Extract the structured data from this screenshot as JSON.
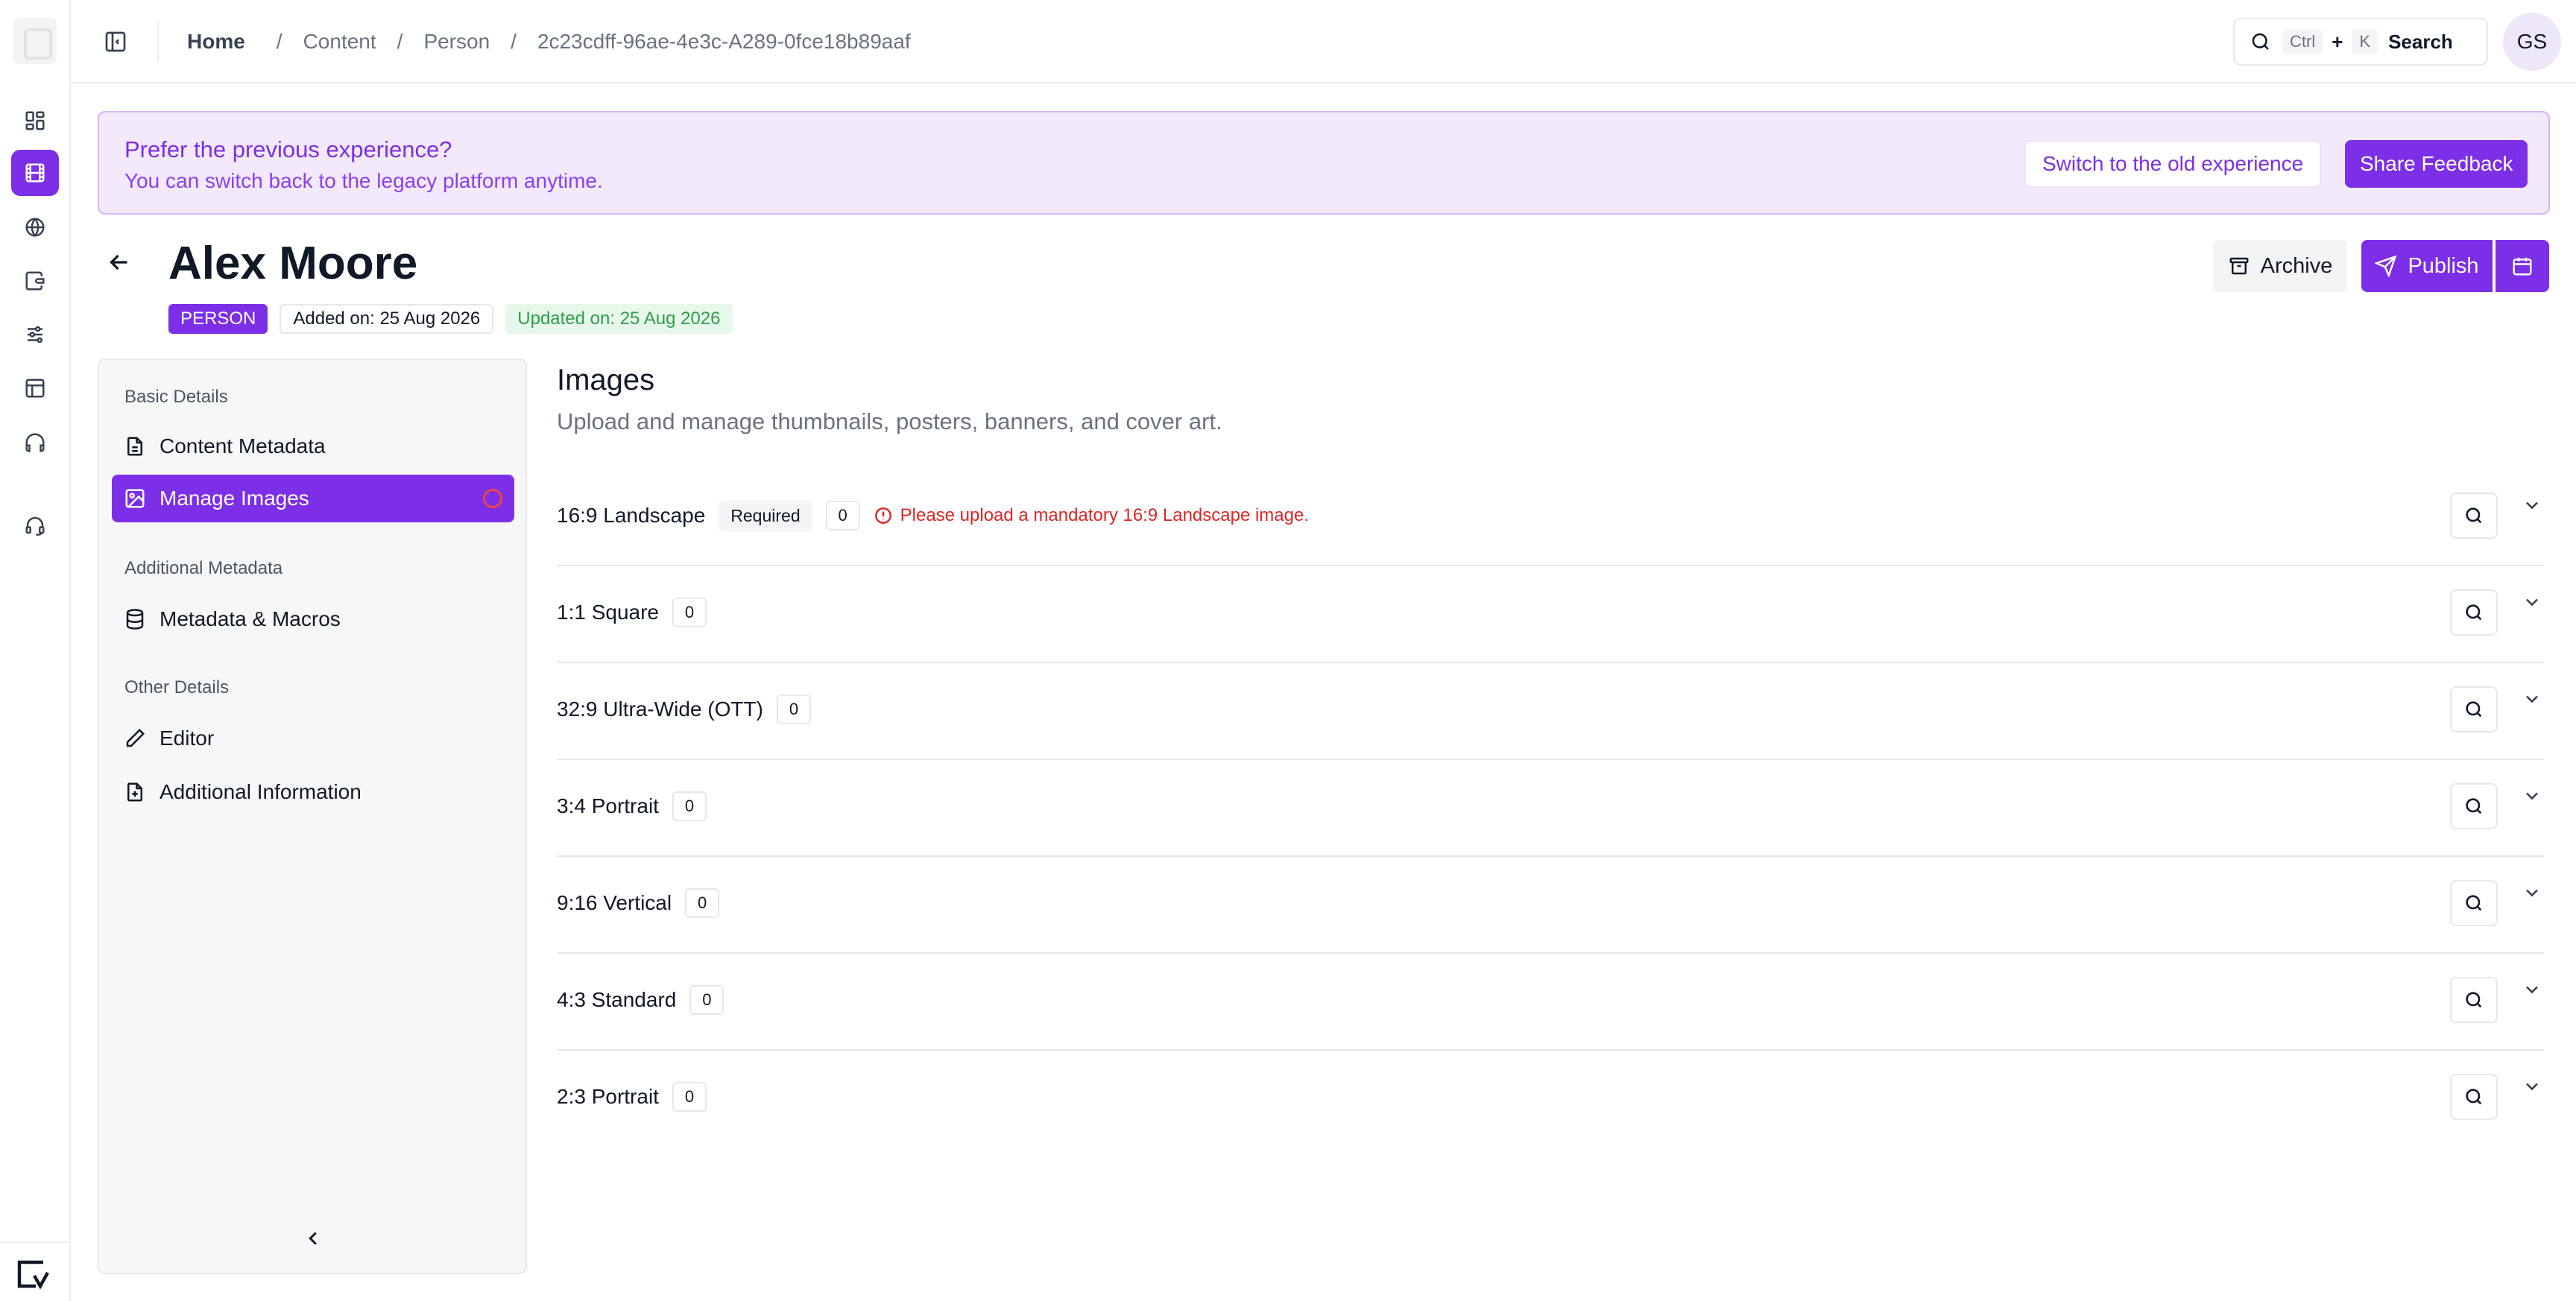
{
  "rail": {
    "items": [
      {
        "name": "dashboard-icon",
        "active": false
      },
      {
        "name": "film-icon",
        "active": true
      },
      {
        "name": "globe-icon",
        "active": false
      },
      {
        "name": "wallet-icon",
        "active": false
      },
      {
        "name": "sliders-icon",
        "active": false
      },
      {
        "name": "layout-icon",
        "active": false
      },
      {
        "name": "headphones-icon",
        "active": false
      },
      {
        "name": "headset-icon",
        "active": false
      }
    ]
  },
  "breadcrumb": {
    "home": "Home",
    "items": [
      "Content",
      "Person",
      "2c23cdff-96ae-4e3c-A289-0fce18b89aaf"
    ]
  },
  "search": {
    "kbd_ctrl": "Ctrl",
    "plus": "+",
    "kbd_key": "K",
    "label": "Search"
  },
  "user": {
    "initials": "GS"
  },
  "banner": {
    "title": "Prefer the previous experience?",
    "subtitle": "You can switch back to the legacy platform anytime.",
    "switch_label": "Switch to the old experience",
    "feedback_label": "Share Feedback"
  },
  "header": {
    "title": "Alex Moore",
    "type_badge": "PERSON",
    "added": "Added on: 25 Aug 2026",
    "updated": "Updated on: 25 Aug 2026",
    "archive_label": "Archive",
    "publish_label": "Publish"
  },
  "nav": {
    "groups": [
      {
        "label": "Basic Details"
      },
      {
        "label": "Additional Metadata"
      },
      {
        "label": "Other Details"
      }
    ],
    "items": [
      {
        "label": "Content Metadata",
        "icon": "document-icon"
      },
      {
        "label": "Manage Images",
        "icon": "image-icon",
        "active": true
      },
      {
        "label": "Metadata & Macros",
        "icon": "database-icon"
      },
      {
        "label": "Editor",
        "icon": "pencil-icon"
      },
      {
        "label": "Additional Information",
        "icon": "file-plus-icon"
      }
    ]
  },
  "main": {
    "title": "Images",
    "subtitle": "Upload and manage thumbnails, posters, banners, and cover art.",
    "rows": [
      {
        "label": "16:9 Landscape",
        "required": "Required",
        "count": "0",
        "error": "Please upload a mandatory 16:9 Landscape image."
      },
      {
        "label": "1:1 Square",
        "count": "0"
      },
      {
        "label": "32:9 Ultra-Wide (OTT)",
        "count": "0"
      },
      {
        "label": "3:4 Portrait",
        "count": "0"
      },
      {
        "label": "9:16 Vertical",
        "count": "0"
      },
      {
        "label": "4:3 Standard",
        "count": "0"
      },
      {
        "label": "2:3 Portrait",
        "count": "0"
      }
    ]
  },
  "colors": {
    "accent": "#7c2fe6",
    "banner_bg": "#f3e9fd",
    "error": "#dc2626",
    "success": "#2f9e4a"
  }
}
